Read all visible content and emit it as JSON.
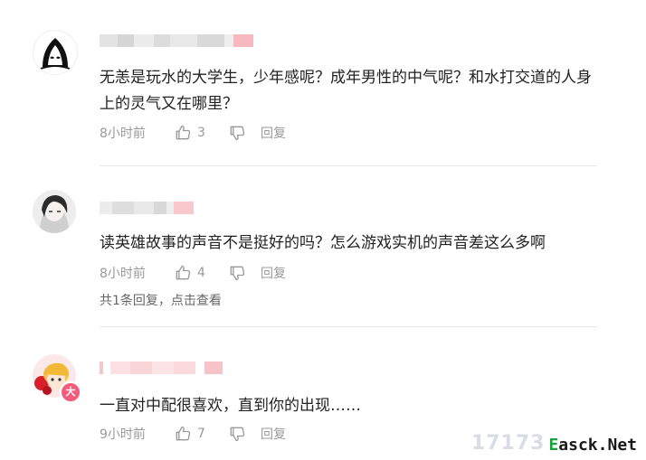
{
  "comments": [
    {
      "text": "无恙是玩水的大学生，少年感呢？成年男性的中气呢？和水打交道的人身上的灵气又在哪里？",
      "time": "8小时前",
      "likes": "3",
      "reply_label": "回复"
    },
    {
      "text": "读英雄故事的声音不是挺好的吗？怎么游戏实机的声音差这么多啊",
      "time": "8小时前",
      "likes": "4",
      "reply_label": "回复",
      "replies_text": "共1条回复，点击查看"
    },
    {
      "text": "一直对中配很喜欢，直到你的出现……",
      "time": "9小时前",
      "likes": "7",
      "reply_label": "回复",
      "badge": "大"
    }
  ],
  "watermark": {
    "faint": "17173",
    "site_prefix": "E",
    "site_rest": "asck.Net"
  }
}
